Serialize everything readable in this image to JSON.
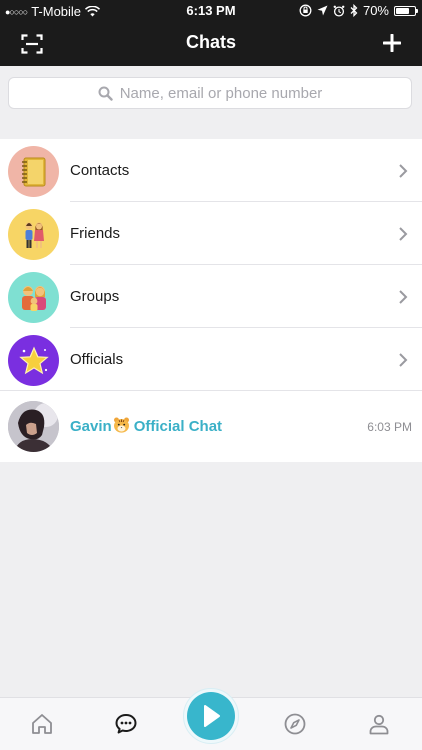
{
  "status_bar": {
    "signal": "●○○○○",
    "carrier": "T-Mobile",
    "time": "6:13 PM",
    "battery_percent_label": "70%",
    "battery_level": 0.7
  },
  "nav": {
    "title": "Chats",
    "left_icon": "scan-icon",
    "right_icon": "plus-icon"
  },
  "search": {
    "placeholder": "Name, email or phone number"
  },
  "menu_items": [
    {
      "label": "Contacts",
      "icon": "notebook-icon",
      "bg": "#f0b5a7"
    },
    {
      "label": "Friends",
      "icon": "couple-icon",
      "bg": "#f7d565"
    },
    {
      "label": "Groups",
      "icon": "family-icon",
      "bg": "#7fe0d2"
    },
    {
      "label": "Officials",
      "icon": "star-icon",
      "bg": "#7a2fe0"
    }
  ],
  "chat": {
    "name": "Gavin",
    "suffix": "Official Chat",
    "time": "6:03 PM"
  },
  "tabs": [
    {
      "name": "home-tab",
      "icon": "home-icon"
    },
    {
      "name": "chats-tab",
      "icon": "chat-bubble-icon"
    },
    {
      "name": "play-tab",
      "icon": "play-icon"
    },
    {
      "name": "discover-tab",
      "icon": "compass-icon"
    },
    {
      "name": "profile-tab",
      "icon": "person-icon"
    }
  ],
  "colors": {
    "header_bg": "#1b1b1b",
    "accent": "#38b6cc",
    "chat_name": "#3bb0c7"
  }
}
